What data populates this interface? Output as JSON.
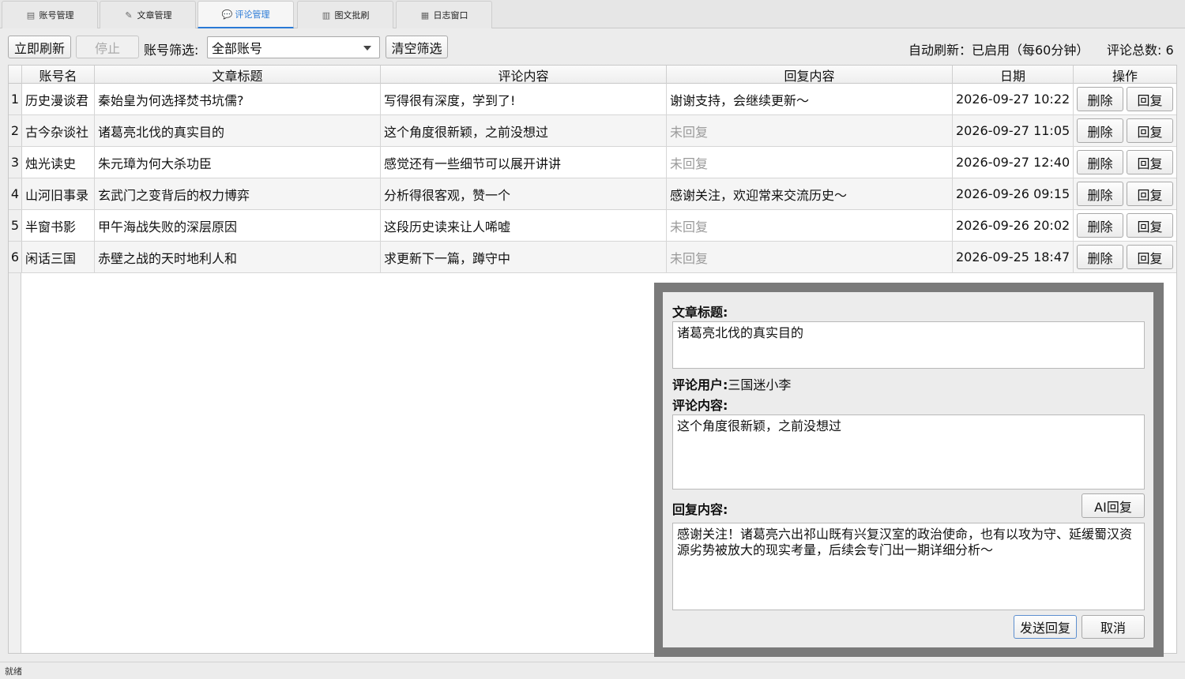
{
  "tabs": [
    {
      "label": "账号管理",
      "icon": "account-book-icon"
    },
    {
      "label": "文章管理",
      "icon": "pencil-note-icon"
    },
    {
      "label": "评论管理",
      "icon": "comment-bubble-icon"
    },
    {
      "label": "图文批刷",
      "icon": "image-stack-icon"
    },
    {
      "label": "日志窗口",
      "icon": "log-file-icon"
    }
  ],
  "active_tab": 2,
  "toolbar": {
    "refresh_label": "立即刷新",
    "stop_label": "停止",
    "filter_label": "账号筛选:",
    "filter_value": "全部账号",
    "clear_label": "清空筛选",
    "auto_refresh": "自动刷新：已启用（每60分钟）",
    "total": "评论总数: 6"
  },
  "table": {
    "headers": [
      "账号名",
      "文章标题",
      "评论内容",
      "回复内容",
      "日期",
      "操作"
    ],
    "delete_label": "删除",
    "reply_label": "回复",
    "rows": [
      {
        "num": "1",
        "account": "历史漫谈君",
        "title": "秦始皇为何选择焚书坑儒?",
        "comment": "写得很有深度，学到了!",
        "reply": "谢谢支持，会继续更新～",
        "replied": true,
        "date": "2026-09-27 10:22"
      },
      {
        "num": "2",
        "account": "古今杂谈社",
        "title": "诸葛亮北伐的真实目的",
        "comment": "这个角度很新颖，之前没想过",
        "reply": "未回复",
        "replied": false,
        "date": "2026-09-27 11:05"
      },
      {
        "num": "3",
        "account": "烛光读史",
        "title": "朱元璋为何大杀功臣",
        "comment": "感觉还有一些细节可以展开讲讲",
        "reply": "未回复",
        "replied": false,
        "date": "2026-09-27 12:40"
      },
      {
        "num": "4",
        "account": "山河旧事录",
        "title": "玄武门之变背后的权力博弈",
        "comment": "分析得很客观，赞一个",
        "reply": "感谢关注，欢迎常来交流历史～",
        "replied": true,
        "date": "2026-09-26 09:15"
      },
      {
        "num": "5",
        "account": "半窗书影",
        "title": "甲午海战失败的深层原因",
        "comment": "这段历史读来让人唏嘘",
        "reply": "未回复",
        "replied": false,
        "date": "2026-09-26 20:02"
      },
      {
        "num": "6",
        "account": "闲话三国",
        "title": "赤壁之战的天时地利人和",
        "comment": "求更新下一篇，蹲守中",
        "reply": "未回复",
        "replied": false,
        "date": "2026-09-25 18:47"
      }
    ]
  },
  "dialog": {
    "title_label": "文章标题:",
    "title_value": "诸葛亮北伐的真实目的",
    "user_label": "评论用户:",
    "user_value": "三国迷小李",
    "comment_label": "评论内容:",
    "comment_value": "这个角度很新颖，之前没想过",
    "reply_label": "回复内容:",
    "ai_reply_label": "AI回复",
    "reply_value": "感谢关注！诸葛亮六出祁山既有兴复汉室的政治使命，也有以攻为守、延缓蜀汉资源劣势被放大的现实考量，后续会专门出一期详细分析～",
    "send_label": "发送回复",
    "cancel_label": "取消"
  },
  "status": "就绪"
}
